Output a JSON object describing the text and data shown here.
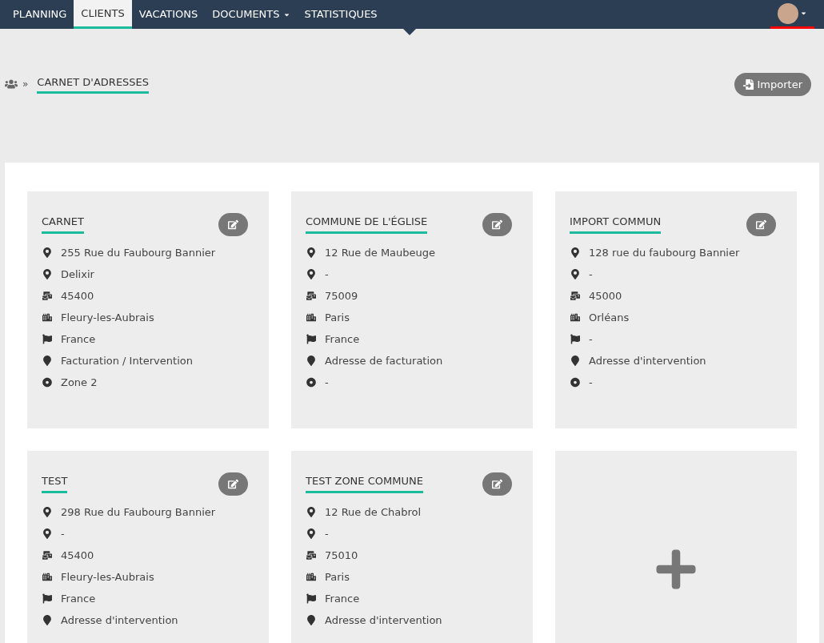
{
  "nav": {
    "items": [
      {
        "label": "PLANNING",
        "selected": false,
        "dropdown": false
      },
      {
        "label": "CLIENTS",
        "selected": true,
        "dropdown": false
      },
      {
        "label": "VACATIONS",
        "selected": false,
        "dropdown": false
      },
      {
        "label": "DOCUMENTS",
        "selected": false,
        "dropdown": true
      },
      {
        "label": "STATISTIQUES",
        "selected": false,
        "dropdown": false
      }
    ]
  },
  "breadcrumb": {
    "separator": "»",
    "title": "CARNET D'ADRESSES"
  },
  "import_button": "Importer",
  "cards": [
    {
      "title": "CARNET",
      "lines": [
        {
          "kind": "address",
          "text": "255 Rue du Faubourg Bannier"
        },
        {
          "kind": "place",
          "text": "Delixir"
        },
        {
          "kind": "postal",
          "text": "45400"
        },
        {
          "kind": "city",
          "text": "Fleury-les-Aubrais"
        },
        {
          "kind": "country",
          "text": "France"
        },
        {
          "kind": "type",
          "text": "Facturation / Intervention"
        },
        {
          "kind": "zone",
          "text": "Zone 2"
        }
      ]
    },
    {
      "title": "COMMUNE DE L'ÉGLISE",
      "lines": [
        {
          "kind": "address",
          "text": "12 Rue de Maubeuge"
        },
        {
          "kind": "place",
          "text": "-"
        },
        {
          "kind": "postal",
          "text": "75009"
        },
        {
          "kind": "city",
          "text": "Paris"
        },
        {
          "kind": "country",
          "text": "France"
        },
        {
          "kind": "type",
          "text": "Adresse de facturation"
        },
        {
          "kind": "zone",
          "text": "-"
        }
      ]
    },
    {
      "title": "IMPORT COMMUN",
      "lines": [
        {
          "kind": "address",
          "text": "128 rue du faubourg Bannier"
        },
        {
          "kind": "place",
          "text": "-"
        },
        {
          "kind": "postal",
          "text": "45000"
        },
        {
          "kind": "city",
          "text": "Orléans"
        },
        {
          "kind": "country",
          "text": "-"
        },
        {
          "kind": "type",
          "text": "Adresse d'intervention"
        },
        {
          "kind": "zone",
          "text": "-"
        }
      ]
    },
    {
      "title": "TEST",
      "lines": [
        {
          "kind": "address",
          "text": "298 Rue du Faubourg Bannier"
        },
        {
          "kind": "place",
          "text": "-"
        },
        {
          "kind": "postal",
          "text": "45400"
        },
        {
          "kind": "city",
          "text": "Fleury-les-Aubrais"
        },
        {
          "kind": "country",
          "text": "France"
        },
        {
          "kind": "type",
          "text": "Adresse d'intervention"
        }
      ]
    },
    {
      "title": "TEST ZONE COMMUNE",
      "lines": [
        {
          "kind": "address",
          "text": "12 Rue de Chabrol"
        },
        {
          "kind": "place",
          "text": "-"
        },
        {
          "kind": "postal",
          "text": "75010"
        },
        {
          "kind": "city",
          "text": "Paris"
        },
        {
          "kind": "country",
          "text": "France"
        },
        {
          "kind": "type",
          "text": "Adresse d'intervention"
        }
      ]
    }
  ]
}
